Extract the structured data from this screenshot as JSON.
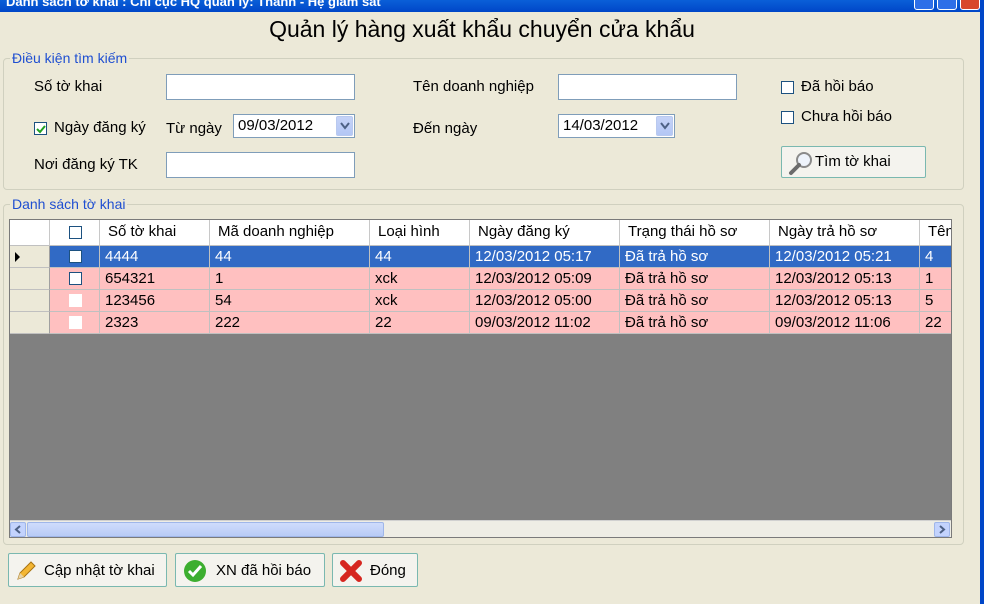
{
  "window": {
    "title": "Danh sách tờ khai : Chi cục HQ quản lý: Thanh - Hệ giám sát"
  },
  "heading": "Quản lý hàng xuất khẩu chuyển cửa khẩu",
  "search": {
    "legend": "Điều kiện tìm kiếm",
    "so_to_khai_label": "Số tờ khai",
    "so_to_khai_value": "",
    "ten_dn_label": "Tên doanh nghiệp",
    "ten_dn_value": "",
    "ngay_dang_ky_label": "Ngày đăng ký",
    "ngay_dang_ky_checked": true,
    "tu_ngay_label": "Từ ngày",
    "tu_ngay_value": "09/03/2012",
    "den_ngay_label": "Đến ngày",
    "den_ngay_value": "14/03/2012",
    "noi_dang_ky_label": "Nơi đăng ký TK",
    "noi_dang_ky_value": "",
    "da_hoi_bao_label": "Đã hồi báo",
    "chua_hoi_bao_label": "Chưa hồi báo",
    "find_button": "Tìm tờ khai"
  },
  "list": {
    "legend": "Danh sách tờ khai",
    "columns": [
      "Số tờ khai",
      "Mã doanh nghiệp",
      "Loại hình",
      "Ngày đăng ký",
      "Trạng thái hồ sơ",
      "Ngày trả hồ sơ",
      "Tên"
    ],
    "rows": [
      {
        "so_tk": "4444",
        "ma_dn": "44",
        "loai_hinh": "44",
        "ngay_dk": "12/03/2012 05:17",
        "trang_thai": "Đã trả hồ sơ",
        "ngay_tra": "12/03/2012 05:21",
        "ten": "4"
      },
      {
        "so_tk": "654321",
        "ma_dn": "1",
        "loai_hinh": "xck",
        "ngay_dk": "12/03/2012 05:09",
        "trang_thai": "Đã trả hồ sơ",
        "ngay_tra": "12/03/2012 05:13",
        "ten": "1"
      },
      {
        "so_tk": "123456",
        "ma_dn": "54",
        "loai_hinh": "xck",
        "ngay_dk": "12/03/2012 05:00",
        "trang_thai": "Đã trả hồ sơ",
        "ngay_tra": "12/03/2012 05:13",
        "ten": "5"
      },
      {
        "so_tk": "2323",
        "ma_dn": "222",
        "loai_hinh": "22",
        "ngay_dk": "09/03/2012 11:02",
        "trang_thai": "Đã trả hồ sơ",
        "ngay_tra": "09/03/2012 11:06",
        "ten": "22"
      }
    ],
    "selected_row": 0,
    "colors": {
      "selected": "#316ac5",
      "row_bg": "#ffc0c0",
      "empty_area": "#808080"
    }
  },
  "buttons": {
    "update": "Cập nhật tờ khai",
    "confirm": "XN đã hồi báo",
    "close": "Đóng"
  },
  "icons": [
    "pencil-icon",
    "check-circle-icon",
    "red-x-icon",
    "magnifier-icon"
  ]
}
